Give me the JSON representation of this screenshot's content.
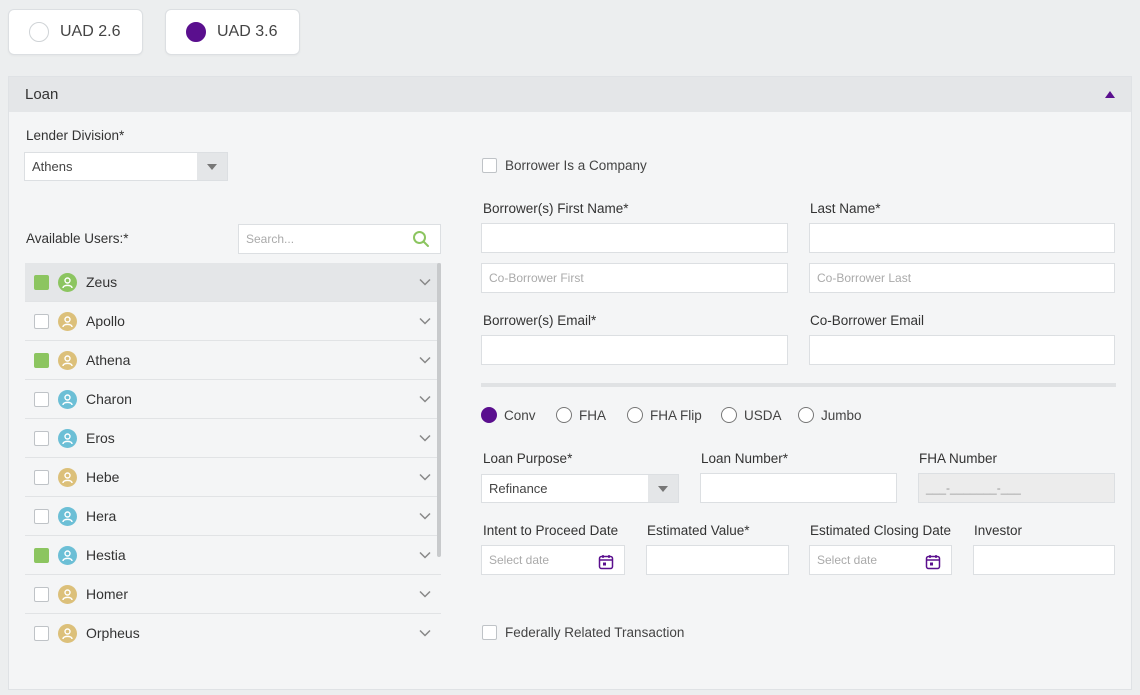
{
  "uad": {
    "options": [
      {
        "label": "UAD 2.6",
        "selected": false
      },
      {
        "label": "UAD 3.6",
        "selected": true
      }
    ]
  },
  "panel": {
    "title": "Loan"
  },
  "lender_division": {
    "label": "Lender Division*",
    "value": "Athens"
  },
  "available_users": {
    "label": "Available Users:*",
    "search_placeholder": "Search...",
    "users": [
      {
        "name": "Zeus",
        "checked": true,
        "avatar_color": "#8cc560"
      },
      {
        "name": "Apollo",
        "checked": false,
        "avatar_color": "#dcc07a"
      },
      {
        "name": "Athena",
        "checked": true,
        "avatar_color": "#dcc07a"
      },
      {
        "name": "Charon",
        "checked": false,
        "avatar_color": "#6cbfd6"
      },
      {
        "name": "Eros",
        "checked": false,
        "avatar_color": "#6cbfd6"
      },
      {
        "name": "Hebe",
        "checked": false,
        "avatar_color": "#dcc07a"
      },
      {
        "name": "Hera",
        "checked": false,
        "avatar_color": "#6cbfd6"
      },
      {
        "name": "Hestia",
        "checked": true,
        "avatar_color": "#6cbfd6"
      },
      {
        "name": "Homer",
        "checked": false,
        "avatar_color": "#dcc07a"
      },
      {
        "name": "Orpheus",
        "checked": false,
        "avatar_color": "#dcc07a"
      }
    ]
  },
  "borrower_company": {
    "label": "Borrower Is a Company"
  },
  "borrower": {
    "first_label": "Borrower(s) First Name*",
    "last_label": "Last Name*",
    "co_first_placeholder": "Co-Borrower First",
    "co_last_placeholder": "Co-Borrower Last",
    "email_label": "Borrower(s) Email*",
    "co_email_label": "Co-Borrower Email"
  },
  "loan_types": [
    {
      "label": "Conv",
      "selected": true
    },
    {
      "label": "FHA",
      "selected": false
    },
    {
      "label": "FHA Flip",
      "selected": false
    },
    {
      "label": "USDA",
      "selected": false
    },
    {
      "label": "Jumbo",
      "selected": false
    }
  ],
  "loan_purpose": {
    "label": "Loan Purpose*",
    "value": "Refinance"
  },
  "loan_number": {
    "label": "Loan Number*"
  },
  "fha_number": {
    "label": "FHA Number",
    "mask": "___-_______-___"
  },
  "intent_date": {
    "label": "Intent to Proceed Date",
    "placeholder": "Select date"
  },
  "estimated_value": {
    "label": "Estimated Value*"
  },
  "closing_date": {
    "label": "Estimated Closing Date",
    "placeholder": "Select date"
  },
  "investor": {
    "label": "Investor"
  },
  "federally_related": {
    "label": "Federally Related Transaction"
  },
  "colors": {
    "accent": "#5a0f8e",
    "check": "#8cc560"
  }
}
